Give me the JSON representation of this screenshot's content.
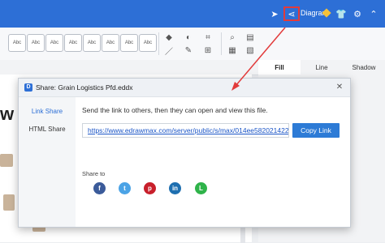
{
  "topbar": {
    "diagram_label": "Diagram"
  },
  "toolbar": {
    "style_buttons": [
      "Abc",
      "Abc",
      "Abc",
      "Abc",
      "Abc",
      "Abc",
      "Abc",
      "Abc"
    ]
  },
  "right_panel": {
    "tabs": [
      "Fill",
      "Line",
      "Shadow"
    ]
  },
  "canvas": {
    "visible_text": "w D"
  },
  "dialog": {
    "title": "Share: Grain Logistics Pfd.eddx",
    "sidebar": [
      "Link Share",
      "HTML Share"
    ],
    "instruction": "Send the link to others, then they can open and view this file.",
    "link": "https://www.edrawmax.com/server/public/s/max/014ee582021422",
    "copy_button": "Copy Link",
    "share_to_label": "Share to",
    "social_icons": [
      "facebook-icon",
      "twitter-icon",
      "pinterest-icon",
      "linkedin-icon",
      "line-icon"
    ]
  },
  "colors": {
    "titlebar": "#2d6fd6",
    "accent": "#2d7bd6",
    "highlight": "#e23b3b"
  }
}
